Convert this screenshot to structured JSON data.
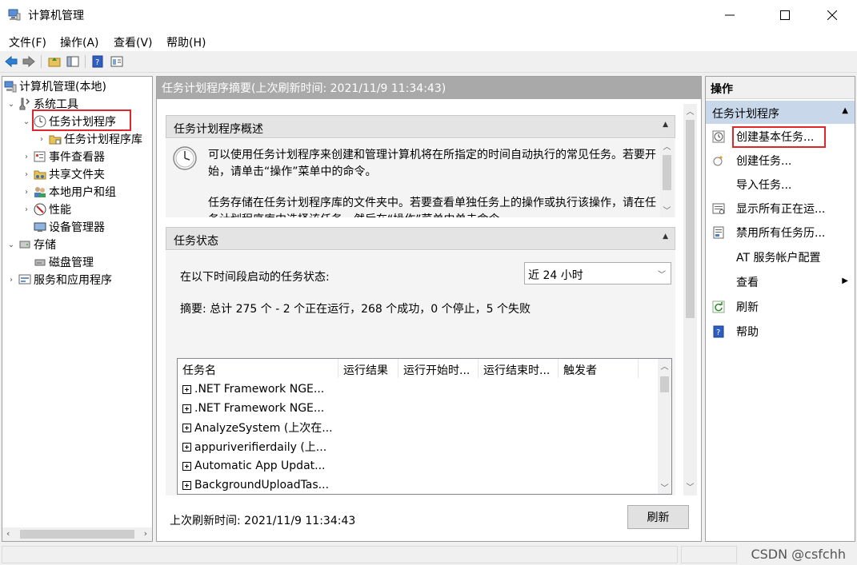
{
  "window": {
    "title": "计算机管理"
  },
  "menu": [
    "文件(F)",
    "操作(A)",
    "查看(V)",
    "帮助(H)"
  ],
  "tree": [
    {
      "label": "计算机管理(本地)",
      "icon": "computer-management-icon"
    },
    {
      "label": "系统工具",
      "icon": "tools-icon"
    },
    {
      "label": "任务计划程序",
      "icon": "clock-icon"
    },
    {
      "label": "任务计划程序库",
      "icon": "folder-icon"
    },
    {
      "label": "事件查看器",
      "icon": "event-viewer-icon"
    },
    {
      "label": "共享文件夹",
      "icon": "shared-folder-icon"
    },
    {
      "label": "本地用户和组",
      "icon": "users-icon"
    },
    {
      "label": "性能",
      "icon": "performance-icon"
    },
    {
      "label": "设备管理器",
      "icon": "device-manager-icon"
    },
    {
      "label": "存储",
      "icon": "storage-icon"
    },
    {
      "label": "磁盘管理",
      "icon": "disk-icon"
    },
    {
      "label": "服务和应用程序",
      "icon": "services-icon"
    }
  ],
  "main": {
    "header": "任务计划程序摘要(上次刷新时间: 2021/11/9 11:34:43)",
    "overview": {
      "title": "任务计划程序概述",
      "para1": "可以使用任务计划程序来创建和管理计算机将在所指定的时间自动执行的常见任务。若要开始，请单击“操作”菜单中的命令。",
      "para2": "任务存储在任务计划程序库的文件夹中。若要查看单独任务上的操作或执行该操作，请在任务计划程序库中选择该任务，然后在“操作”菜单中单击命令。"
    },
    "status": {
      "title": "任务状态",
      "period_label": "在以下时间段启动的任务状态:",
      "period_value": "近 24 小时",
      "summary": "摘要: 总计 275 个 - 2 个正在运行，268 个成功，0 个停止，5 个失败",
      "columns": [
        "任务名",
        "运行结果",
        "运行开始时...",
        "运行结束时...",
        "触发者"
      ],
      "rows": [
        ".NET Framework NGE...",
        ".NET Framework NGE...",
        "AnalyzeSystem (上次在...",
        "appuriverifierdaily (上...",
        "Automatic App Updat...",
        "BackgroundUploadTas..."
      ]
    },
    "footer_text": "上次刷新时间: 2021/11/9 11:34:43",
    "refresh_button": "刷新"
  },
  "actions": {
    "title": "操作",
    "section": "任务计划程序",
    "items": [
      {
        "label": "创建基本任务...",
        "icon": "create-basic-task-icon"
      },
      {
        "label": "创建任务...",
        "icon": "create-task-icon"
      },
      {
        "label": "导入任务...",
        "icon": ""
      },
      {
        "label": "显示所有正在运...",
        "icon": "running-tasks-icon"
      },
      {
        "label": "禁用所有任务历...",
        "icon": "disable-history-icon"
      },
      {
        "label": "AT 服务帐户配置",
        "icon": ""
      },
      {
        "label": "查看",
        "icon": ""
      },
      {
        "label": "刷新",
        "icon": "refresh-icon"
      },
      {
        "label": "帮助",
        "icon": "help-icon"
      }
    ]
  },
  "watermark": "CSDN @csfchh"
}
